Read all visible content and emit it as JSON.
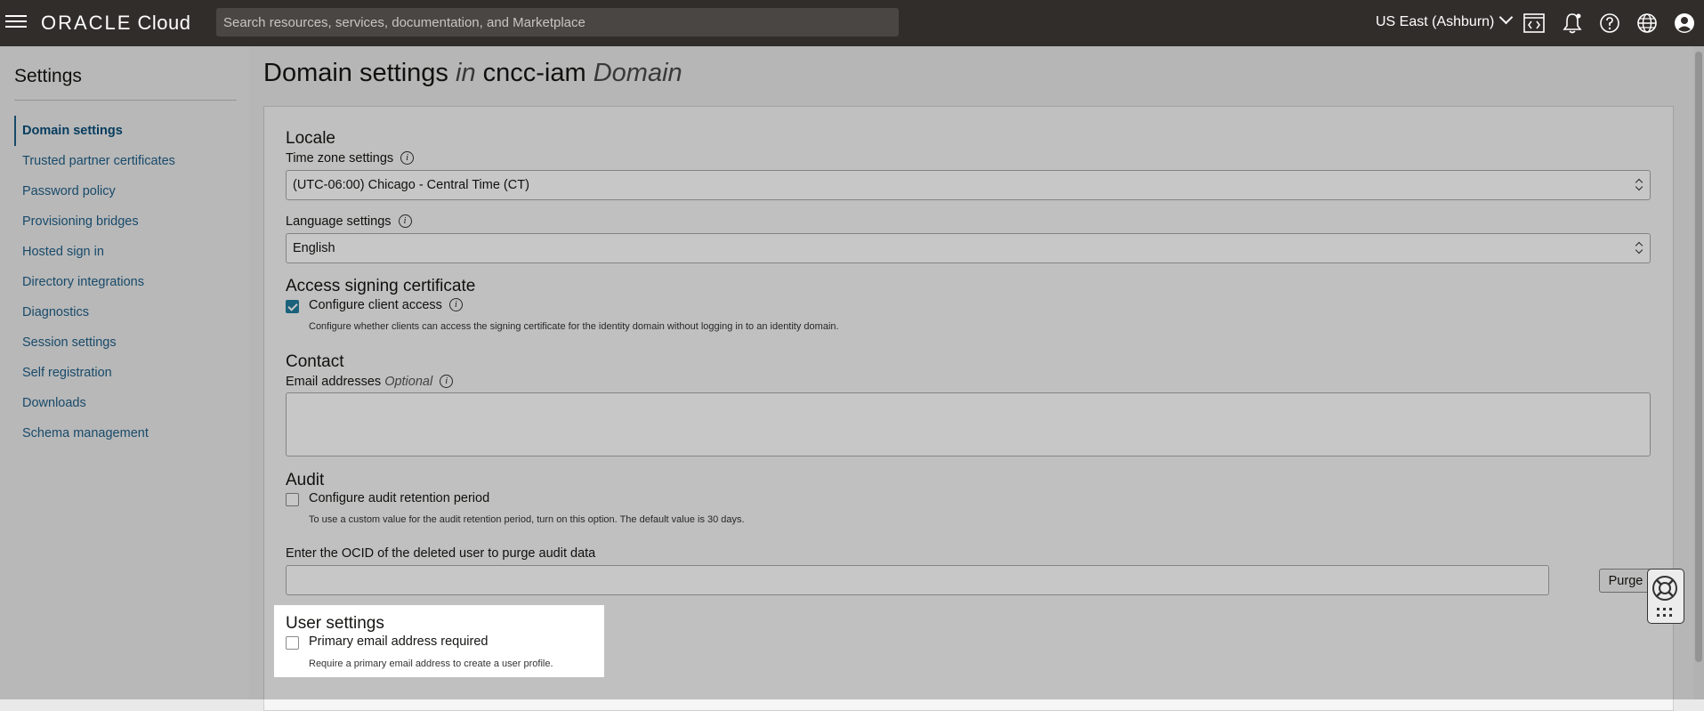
{
  "topbar": {
    "brand": "ORACLE",
    "product": "Cloud",
    "search_placeholder": "Search resources, services, documentation, and Marketplace",
    "region": "US East (Ashburn)",
    "icons": [
      "code-editor-icon",
      "bell-icon",
      "help-icon",
      "globe-icon",
      "profile-icon"
    ]
  },
  "sidebar": {
    "title": "Settings",
    "items": [
      {
        "label": "Domain settings",
        "active": true
      },
      {
        "label": "Trusted partner certificates"
      },
      {
        "label": "Password policy"
      },
      {
        "label": "Provisioning bridges"
      },
      {
        "label": "Hosted sign in"
      },
      {
        "label": "Directory integrations"
      },
      {
        "label": "Diagnostics"
      },
      {
        "label": "Session settings"
      },
      {
        "label": "Self registration"
      },
      {
        "label": "Downloads"
      },
      {
        "label": "Schema management"
      }
    ]
  },
  "page": {
    "title_main": "Domain settings",
    "title_in": "in",
    "title_domain": "cncc-iam",
    "title_suffix": "Domain"
  },
  "locale": {
    "heading": "Locale",
    "timezone_label": "Time zone settings",
    "timezone_value": "(UTC-06:00) Chicago - Central Time (CT)",
    "language_label": "Language settings",
    "language_value": "English"
  },
  "access": {
    "heading": "Access signing certificate",
    "checkbox_label": "Configure client access",
    "checked": true,
    "help": "Configure whether clients can access the signing certificate for the identity domain without logging in to an identity domain."
  },
  "contact": {
    "heading": "Contact",
    "email_label": "Email addresses",
    "optional": "Optional",
    "email_value": ""
  },
  "audit": {
    "heading": "Audit",
    "checkbox_label": "Configure audit retention period",
    "checked": false,
    "help": "To use a custom value for the audit retention period, turn on this option. The default value is 30 days.",
    "ocid_label": "Enter the OCID of the deleted user to purge audit data",
    "ocid_value": "",
    "purge_label": "Purge"
  },
  "user_settings": {
    "heading": "User settings",
    "checkbox_label": "Primary email address required",
    "checked": false,
    "help": "Require a primary email address to create a user profile."
  },
  "colors": {
    "topbar": "#312d2a",
    "link": "#1f5f88",
    "checkbox_checked": "#227e9e"
  }
}
